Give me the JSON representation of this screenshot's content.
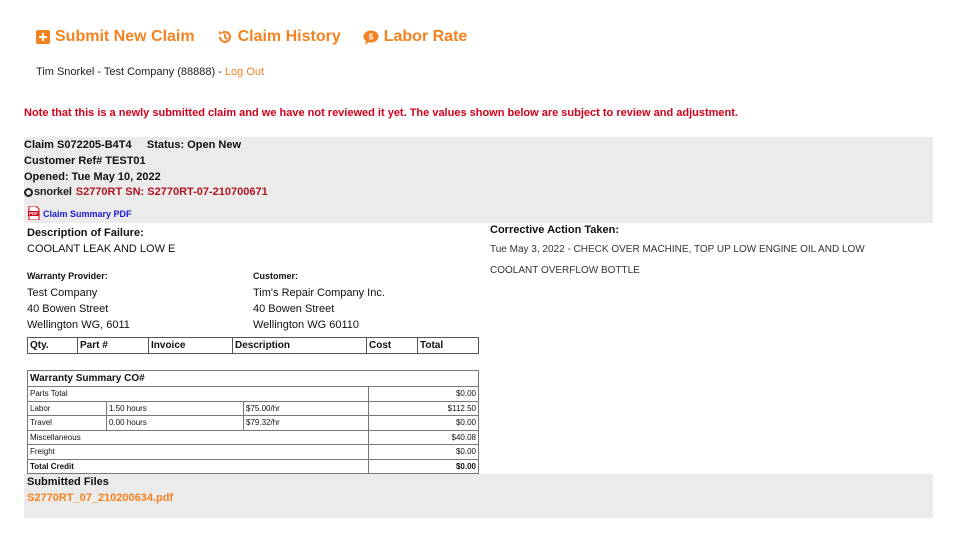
{
  "nav": {
    "submit_label": "Submit New Claim",
    "history_label": "Claim History",
    "labor_label": "Labor Rate"
  },
  "user": {
    "text": "Tim Snorkel - Test Company (88888) - ",
    "logout_label": "Log Out"
  },
  "notice": "Note that this is a newly submitted claim and we have not reviewed it yet. The values shown below are subject to review and adjustment.",
  "claim": {
    "id_line": "Claim S072205-B4T4     Status: Open New",
    "customer_ref": "Customer Ref# TEST01",
    "opened": "Opened: Tue May 10, 2022",
    "brand": "snorkel",
    "model_serial": "S2770RT SN: S2770RT-07-210700671",
    "pdf_label": "Claim Summary PDF"
  },
  "failure": {
    "label": "Description of Failure:",
    "value": "COOLANT LEAK AND LOW E"
  },
  "corrective": {
    "label": "Corrective Action Taken:",
    "value": "Tue May 3, 2022 - CHECK OVER MACHINE, TOP UP LOW ENGINE OIL AND LOW COOLANT OVERFLOW BOTTLE"
  },
  "warranty_provider": {
    "label": "Warranty Provider:",
    "name": "Test Company",
    "street": "40 Bowen Street",
    "city": "Wellington WG, 6011"
  },
  "customer": {
    "label": "Customer:",
    "name": "Tim's Repair Company Inc.",
    "street": "40 Bowen Street",
    "city": "Wellington WG 60110"
  },
  "parts_table": {
    "headers": [
      "Qty.",
      "Part #",
      "Invoice",
      "Description",
      "Cost",
      "Total"
    ]
  },
  "summary": {
    "title": "Warranty Summary CO#",
    "rows": [
      {
        "label": "Parts Total",
        "hours": "",
        "rate": "",
        "amount": "$0.00"
      },
      {
        "label": "Labor",
        "hours": "1.50 hours",
        "rate": "$75.00/hr",
        "amount": "$112.50"
      },
      {
        "label": "Travel",
        "hours": "0.00 hours",
        "rate": "$79.32/hr",
        "amount": "$0.00"
      },
      {
        "label": "Miscellaneous",
        "hours": "",
        "rate": "",
        "amount": "$40.08"
      },
      {
        "label": "Freight",
        "hours": "",
        "rate": "",
        "amount": "$0.00"
      },
      {
        "label": "Total Credit",
        "hours": "",
        "rate": "",
        "amount": "$0.00"
      }
    ]
  },
  "files": {
    "label": "Submitted Files",
    "file_name": "S2770RT_07_210200634.pdf"
  },
  "colors": {
    "accent": "#f58220",
    "notice": "#d0021b",
    "model": "#b0151f",
    "pdf_link": "#1a1adb",
    "panel": "#ebebeb"
  }
}
